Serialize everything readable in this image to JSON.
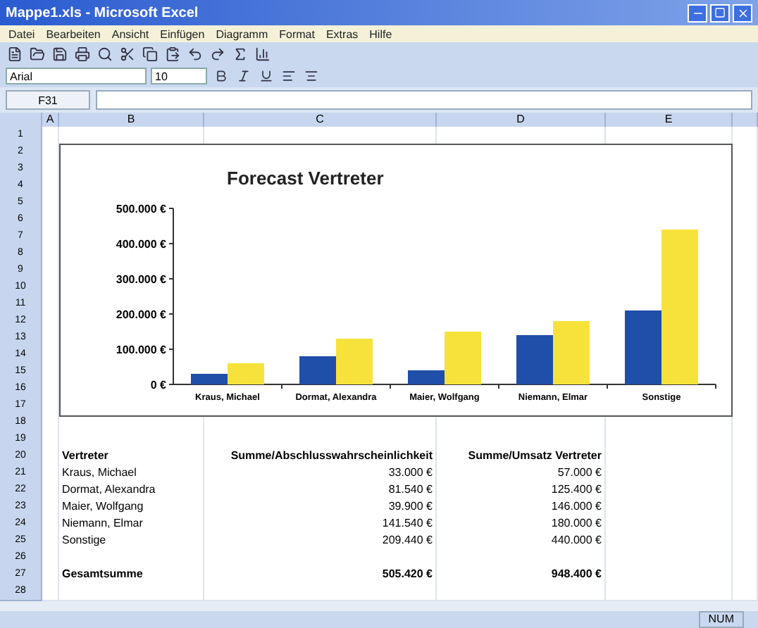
{
  "window": {
    "title": "Mappe1.xls - Microsoft Excel"
  },
  "menu": [
    "Datei",
    "Bearbeiten",
    "Ansicht",
    "Einfügen",
    "Diagramm",
    "Format",
    "Extras",
    "Hilfe"
  ],
  "format_bar": {
    "font": "Arial",
    "size": "10"
  },
  "formula_bar": {
    "cell": "F31"
  },
  "columns": [
    "A",
    "B",
    "C",
    "D",
    "E"
  ],
  "row_numbers": [
    "1",
    "2",
    "3",
    "4",
    "5",
    "6",
    "7",
    "8",
    "9",
    "10",
    "11",
    "12",
    "13",
    "14",
    "15",
    "16",
    "17",
    "18",
    "19",
    "20",
    "21",
    "22",
    "23",
    "24",
    "25",
    "26",
    "27",
    "28"
  ],
  "chart": {
    "chart_data": {
      "type": "bar",
      "title": "Forecast Vertreter",
      "categories": [
        "Kraus, Michael",
        "Dormat, Alexandra",
        "Maier, Wolfgang",
        "Niemann, Elmar",
        "Sonstige"
      ],
      "series": [
        {
          "color": "#1f4fa8",
          "values": [
            30000,
            80000,
            40000,
            140000,
            210000
          ]
        },
        {
          "color": "#f7e23c",
          "values": [
            60000,
            130000,
            150000,
            180000,
            440000
          ]
        }
      ],
      "ylim": [
        0,
        500000
      ],
      "yticks": [
        {
          "value": 0,
          "label": "0 €"
        },
        {
          "value": 100000,
          "label": "100.000 €"
        },
        {
          "value": 200000,
          "label": "200.000 €"
        },
        {
          "value": 300000,
          "label": "300.000 €"
        },
        {
          "value": 400000,
          "label": "400.000 €"
        },
        {
          "value": 500000,
          "label": "500.000 €"
        }
      ]
    }
  },
  "table": {
    "header": [
      "Vertreter",
      "Summe/Abschlusswahrscheinlichkeit",
      "Summe/Umsatz Vertreter"
    ],
    "rows": [
      [
        "Kraus, Michael",
        "33.000 €",
        "57.000 €"
      ],
      [
        "Dormat, Alexandra",
        "81.540 €",
        "125.400 €"
      ],
      [
        "Maier, Wolfgang",
        "39.900 €",
        "146.000 €"
      ],
      [
        "Niemann, Elmar",
        "141.540 €",
        "180.000 €"
      ],
      [
        "Sonstige",
        "209.440 €",
        "440.000 €"
      ]
    ],
    "total": [
      "Gesamtsumme",
      "505.420 €",
      "948.400 €"
    ]
  },
  "status_bar": {
    "mode": "NUM"
  }
}
